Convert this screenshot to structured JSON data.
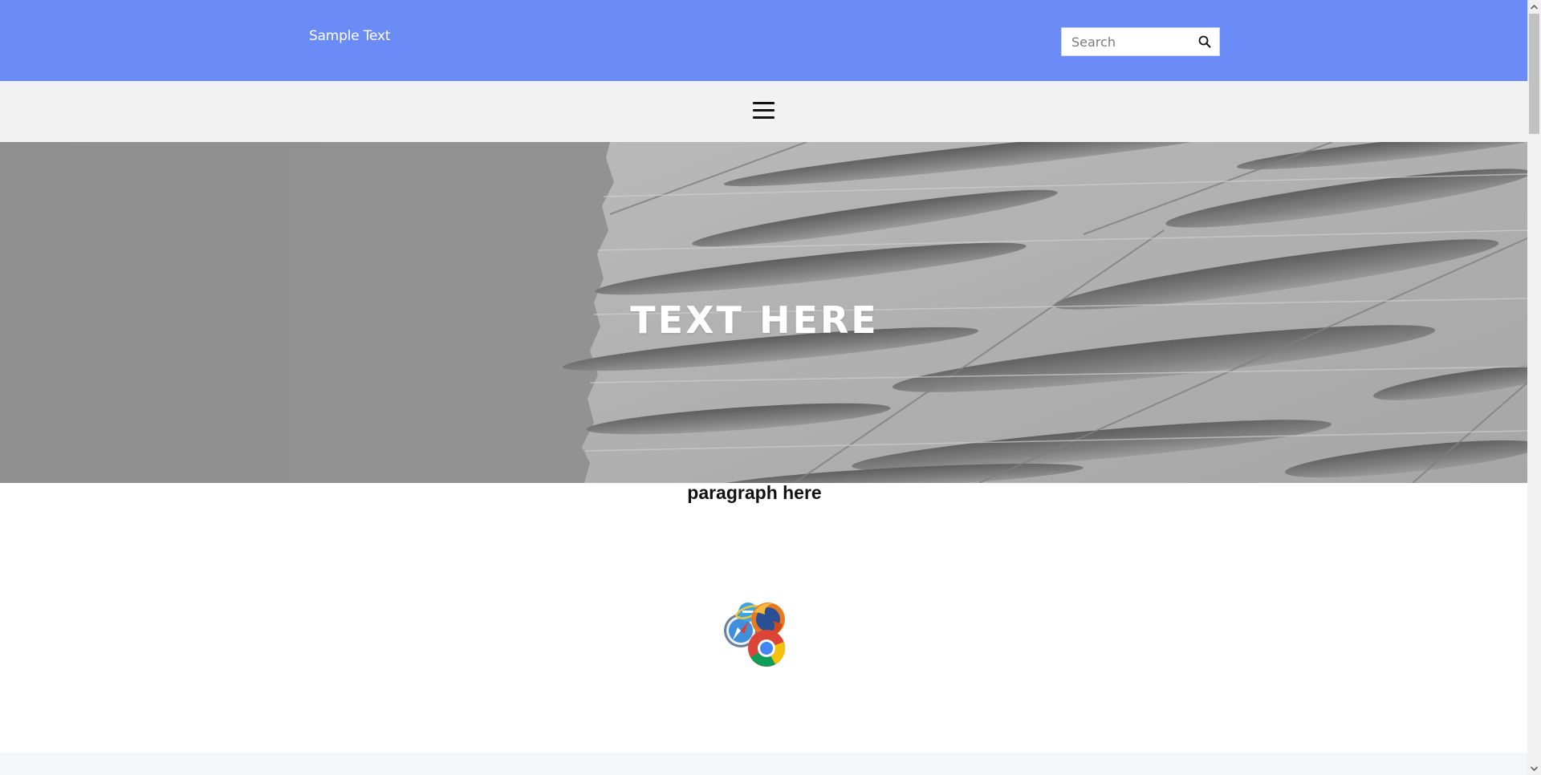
{
  "header": {
    "brand_text": "Sample Text",
    "background_color": "#6b8cf6",
    "search": {
      "placeholder": "Search",
      "value": "",
      "icon": "search-icon"
    }
  },
  "nav": {
    "menu_icon": "hamburger-menu-icon",
    "background_color": "#f2f2f2"
  },
  "hero": {
    "title": "TEXT HERE",
    "image": "grayscale architectural facade with wavy horizontal panels"
  },
  "content": {
    "paragraph": "paragraph here",
    "icon": "browser-logos-icon"
  },
  "scrollbar": {
    "up_icon": "chevron-up-icon",
    "down_icon": "chevron-down-icon"
  }
}
